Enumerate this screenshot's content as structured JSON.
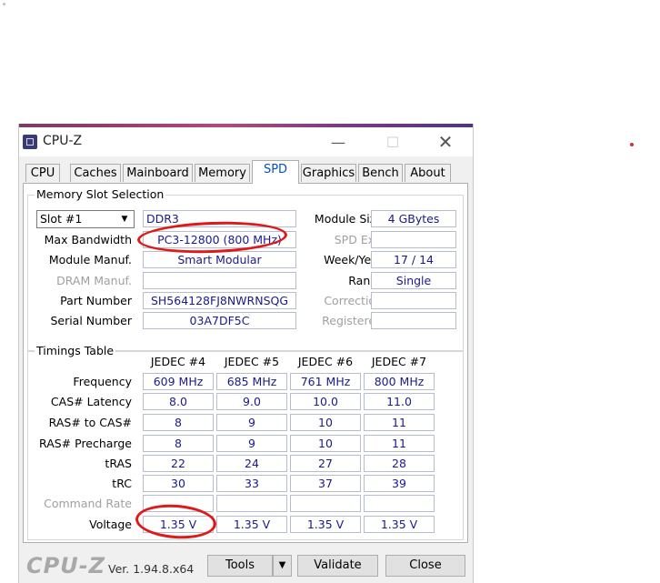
{
  "window": {
    "title": "CPU-Z"
  },
  "tabs": [
    {
      "label": "CPU"
    },
    {
      "label": "Caches"
    },
    {
      "label": "Mainboard"
    },
    {
      "label": "Memory"
    },
    {
      "label": "SPD"
    },
    {
      "label": "Graphics"
    },
    {
      "label": "Bench"
    },
    {
      "label": "About"
    }
  ],
  "active_tab": "SPD",
  "memory_slot": {
    "group_title": "Memory Slot Selection",
    "slot_value": "Slot #1",
    "type_value": "DDR3",
    "labels": {
      "max_bandwidth": "Max Bandwidth",
      "module_manuf": "Module Manuf.",
      "dram_manuf": "DRAM Manuf.",
      "part_number": "Part Number",
      "serial_number": "Serial Number",
      "module_size": "Module Size",
      "spd_ext": "SPD Ext.",
      "week_year": "Week/Year",
      "ranks": "Ranks",
      "correction": "Correction",
      "registered": "Registered"
    },
    "values": {
      "max_bandwidth": "PC3-12800 (800 MHz)",
      "module_manuf": "Smart Modular",
      "dram_manuf": "",
      "part_number": "SH564128FJ8NWRNSQG",
      "serial_number": "03A7DF5C",
      "module_size": "4 GBytes",
      "spd_ext": "",
      "week_year": "17 / 14",
      "ranks": "Single",
      "correction": "",
      "registered": ""
    }
  },
  "timings": {
    "group_title": "Timings Table",
    "columns": [
      "JEDEC #4",
      "JEDEC #5",
      "JEDEC #6",
      "JEDEC #7"
    ],
    "rows": [
      {
        "label": "Frequency",
        "values": [
          "609 MHz",
          "685 MHz",
          "761 MHz",
          "800 MHz"
        ]
      },
      {
        "label": "CAS# Latency",
        "values": [
          "8.0",
          "9.0",
          "10.0",
          "11.0"
        ]
      },
      {
        "label": "RAS# to CAS#",
        "values": [
          "8",
          "9",
          "10",
          "11"
        ]
      },
      {
        "label": "RAS# Precharge",
        "values": [
          "8",
          "9",
          "10",
          "11"
        ]
      },
      {
        "label": "tRAS",
        "values": [
          "22",
          "24",
          "27",
          "28"
        ]
      },
      {
        "label": "tRC",
        "values": [
          "30",
          "33",
          "37",
          "39"
        ]
      },
      {
        "label": "Command Rate",
        "values": [
          "",
          "",
          "",
          ""
        ]
      },
      {
        "label": "Voltage",
        "values": [
          "1.35 V",
          "1.35 V",
          "1.35 V",
          "1.35 V"
        ]
      }
    ]
  },
  "footer": {
    "logo": "CPU-Z",
    "version": "Ver. 1.94.8.x64",
    "tools_label": "Tools",
    "validate_label": "Validate",
    "close_label": "Close"
  },
  "colors": {
    "value_text": "#1a1a8c",
    "annotation": "#e01818",
    "active_tab": "#0050c8"
  }
}
